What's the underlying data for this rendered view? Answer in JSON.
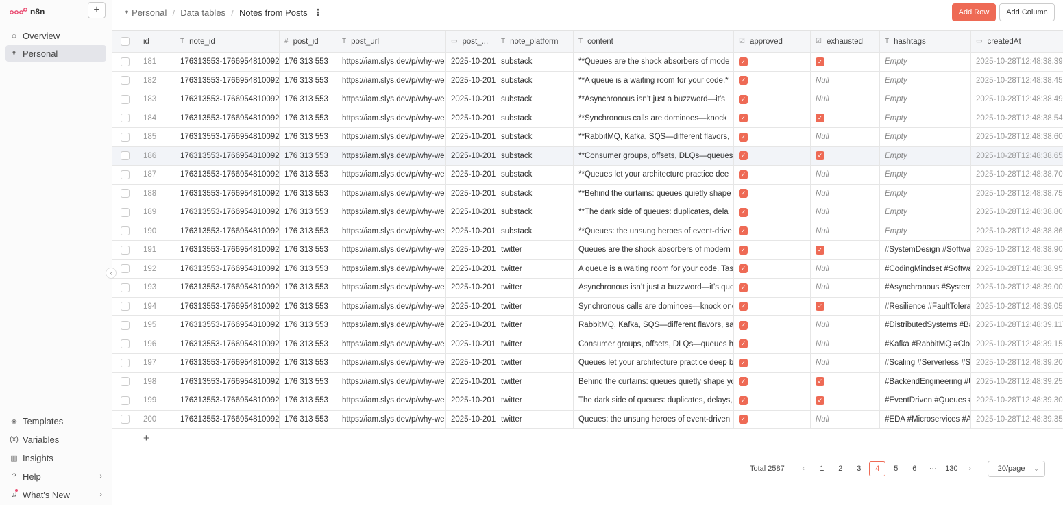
{
  "app": {
    "name": "n8n"
  },
  "sidebar": {
    "top": [
      {
        "label": "Overview",
        "icon": "home-icon"
      },
      {
        "label": "Personal",
        "icon": "user-icon"
      }
    ],
    "bottom": [
      {
        "label": "Templates",
        "icon": "templates-icon"
      },
      {
        "label": "Variables",
        "icon": "variables-icon"
      },
      {
        "label": "Insights",
        "icon": "insights-icon"
      },
      {
        "label": "Help",
        "icon": "help-icon"
      },
      {
        "label": "What's New",
        "icon": "bell-icon"
      }
    ]
  },
  "breadcrumb": {
    "personal": "Personal",
    "tables": "Data tables",
    "current": "Notes from Posts"
  },
  "toolbar": {
    "add_row": "Add Row",
    "add_column": "Add Column"
  },
  "table": {
    "headers": {
      "id": "id",
      "note_id": "note_id",
      "post_id": "post_id",
      "post_url": "post_url",
      "post_date": "post_...",
      "note_platform": "note_platform",
      "content": "content",
      "approved": "approved",
      "exhausted": "exhausted",
      "hashtags": "hashtags",
      "createdAt": "createdAt"
    },
    "rows": [
      {
        "id": "181",
        "note_id": "176313553-1766954810092-",
        "post_id": "176 313 553",
        "post_url": "https://iam.slys.dev/p/why-we",
        "post_date": "2025-10-201",
        "platform": "substack",
        "content": "**Queues are the shock absorbers of mode",
        "approved": true,
        "exhausted": true,
        "hashtags": "Empty",
        "createdAt": "2025-10-28T12:48:38.39"
      },
      {
        "id": "182",
        "note_id": "176313553-1766954810092-",
        "post_id": "176 313 553",
        "post_url": "https://iam.slys.dev/p/why-we",
        "post_date": "2025-10-201",
        "platform": "substack",
        "content": "**A queue is a waiting room for your code.*",
        "approved": true,
        "exhausted": false,
        "hashtags": "Empty",
        "createdAt": "2025-10-28T12:48:38.45"
      },
      {
        "id": "183",
        "note_id": "176313553-1766954810092-",
        "post_id": "176 313 553",
        "post_url": "https://iam.slys.dev/p/why-we",
        "post_date": "2025-10-201",
        "platform": "substack",
        "content": "**Asynchronous isn’t just a buzzword—it’s ",
        "approved": true,
        "exhausted": false,
        "hashtags": "Empty",
        "createdAt": "2025-10-28T12:48:38.49"
      },
      {
        "id": "184",
        "note_id": "176313553-1766954810092-",
        "post_id": "176 313 553",
        "post_url": "https://iam.slys.dev/p/why-we",
        "post_date": "2025-10-201",
        "platform": "substack",
        "content": "**Synchronous calls are dominoes—knock",
        "approved": true,
        "exhausted": true,
        "hashtags": "Empty",
        "createdAt": "2025-10-28T12:48:38.54"
      },
      {
        "id": "185",
        "note_id": "176313553-1766954810092-",
        "post_id": "176 313 553",
        "post_url": "https://iam.slys.dev/p/why-we",
        "post_date": "2025-10-201",
        "platform": "substack",
        "content": "**RabbitMQ, Kafka, SQS—different flavors,",
        "approved": true,
        "exhausted": false,
        "hashtags": "Empty",
        "createdAt": "2025-10-28T12:48:38.60"
      },
      {
        "id": "186",
        "note_id": "176313553-1766954810092-",
        "post_id": "176 313 553",
        "post_url": "https://iam.slys.dev/p/why-we",
        "post_date": "2025-10-201",
        "platform": "substack",
        "content": "**Consumer groups, offsets, DLQs—queues",
        "approved": true,
        "exhausted": true,
        "hashtags": "Empty",
        "createdAt": "2025-10-28T12:48:38.65"
      },
      {
        "id": "187",
        "note_id": "176313553-1766954810092-",
        "post_id": "176 313 553",
        "post_url": "https://iam.slys.dev/p/why-we",
        "post_date": "2025-10-201",
        "platform": "substack",
        "content": "**Queues let your architecture practice dee",
        "approved": true,
        "exhausted": false,
        "hashtags": "Empty",
        "createdAt": "2025-10-28T12:48:38.70"
      },
      {
        "id": "188",
        "note_id": "176313553-1766954810092-",
        "post_id": "176 313 553",
        "post_url": "https://iam.slys.dev/p/why-we",
        "post_date": "2025-10-201",
        "platform": "substack",
        "content": "**Behind the curtains: queues quietly shape",
        "approved": true,
        "exhausted": false,
        "hashtags": "Empty",
        "createdAt": "2025-10-28T12:48:38.75"
      },
      {
        "id": "189",
        "note_id": "176313553-1766954810092-",
        "post_id": "176 313 553",
        "post_url": "https://iam.slys.dev/p/why-we",
        "post_date": "2025-10-201",
        "platform": "substack",
        "content": "**The dark side of queues: duplicates, dela",
        "approved": true,
        "exhausted": false,
        "hashtags": "Empty",
        "createdAt": "2025-10-28T12:48:38.80"
      },
      {
        "id": "190",
        "note_id": "176313553-1766954810092-",
        "post_id": "176 313 553",
        "post_url": "https://iam.slys.dev/p/why-we",
        "post_date": "2025-10-201",
        "platform": "substack",
        "content": "**Queues: the unsung heroes of event-drive",
        "approved": true,
        "exhausted": false,
        "hashtags": "Empty",
        "createdAt": "2025-10-28T12:48:38.86"
      },
      {
        "id": "191",
        "note_id": "176313553-1766954810092-",
        "post_id": "176 313 553",
        "post_url": "https://iam.slys.dev/p/why-we",
        "post_date": "2025-10-201",
        "platform": "twitter",
        "content": "Queues are the shock absorbers of modern",
        "approved": true,
        "exhausted": true,
        "hashtags": "#SystemDesign #Softwa",
        "createdAt": "2025-10-28T12:48:38.90"
      },
      {
        "id": "192",
        "note_id": "176313553-1766954810092-",
        "post_id": "176 313 553",
        "post_url": "https://iam.slys.dev/p/why-we",
        "post_date": "2025-10-201",
        "platform": "twitter",
        "content": "A queue is a waiting room for your code. Tas",
        "approved": true,
        "exhausted": false,
        "hashtags": "#CodingMindset #Softwa",
        "createdAt": "2025-10-28T12:48:38.95"
      },
      {
        "id": "193",
        "note_id": "176313553-1766954810092-",
        "post_id": "176 313 553",
        "post_url": "https://iam.slys.dev/p/why-we",
        "post_date": "2025-10-201",
        "platform": "twitter",
        "content": "Asynchronous isn’t just a buzzword—it’s que",
        "approved": true,
        "exhausted": false,
        "hashtags": "#Asynchronous #System",
        "createdAt": "2025-10-28T12:48:39.00"
      },
      {
        "id": "194",
        "note_id": "176313553-1766954810092-",
        "post_id": "176 313 553",
        "post_url": "https://iam.slys.dev/p/why-we",
        "post_date": "2025-10-201",
        "platform": "twitter",
        "content": "Synchronous calls are dominoes—knock one",
        "approved": true,
        "exhausted": true,
        "hashtags": "#Resilience #FaultTolera",
        "createdAt": "2025-10-28T12:48:39.05"
      },
      {
        "id": "195",
        "note_id": "176313553-1766954810092-",
        "post_id": "176 313 553",
        "post_url": "https://iam.slys.dev/p/why-we",
        "post_date": "2025-10-201",
        "platform": "twitter",
        "content": "RabbitMQ, Kafka, SQS—different flavors, sar",
        "approved": true,
        "exhausted": false,
        "hashtags": "#DistributedSystems #Ba",
        "createdAt": "2025-10-28T12:48:39.117"
      },
      {
        "id": "196",
        "note_id": "176313553-1766954810092-",
        "post_id": "176 313 553",
        "post_url": "https://iam.slys.dev/p/why-we",
        "post_date": "2025-10-201",
        "platform": "twitter",
        "content": "Consumer groups, offsets, DLQs—queues ha",
        "approved": true,
        "exhausted": false,
        "hashtags": "#Kafka #RabbitMQ #Clou",
        "createdAt": "2025-10-28T12:48:39.159"
      },
      {
        "id": "197",
        "note_id": "176313553-1766954810092-",
        "post_id": "176 313 553",
        "post_url": "https://iam.slys.dev/p/why-we",
        "post_date": "2025-10-201",
        "platform": "twitter",
        "content": "Queues let your architecture practice deep b",
        "approved": true,
        "exhausted": false,
        "hashtags": "#Scaling #Serverless #S",
        "createdAt": "2025-10-28T12:48:39.20"
      },
      {
        "id": "198",
        "note_id": "176313553-1766954810092-",
        "post_id": "176 313 553",
        "post_url": "https://iam.slys.dev/p/why-we",
        "post_date": "2025-10-201",
        "platform": "twitter",
        "content": "Behind the curtains: queues quietly shape yo",
        "approved": true,
        "exhausted": true,
        "hashtags": "#BackendEngineering #U",
        "createdAt": "2025-10-28T12:48:39.25"
      },
      {
        "id": "199",
        "note_id": "176313553-1766954810092-",
        "post_id": "176 313 553",
        "post_url": "https://iam.slys.dev/p/why-we",
        "post_date": "2025-10-201",
        "platform": "twitter",
        "content": "The dark side of queues: duplicates, delays,",
        "approved": true,
        "exhausted": true,
        "hashtags": "#EventDriven #Queues #",
        "createdAt": "2025-10-28T12:48:39.30"
      },
      {
        "id": "200",
        "note_id": "176313553-1766954810092-",
        "post_id": "176 313 553",
        "post_url": "https://iam.slys.dev/p/why-we",
        "post_date": "2025-10-201",
        "platform": "twitter",
        "content": "Queues: the unsung heroes of event-driven",
        "approved": true,
        "exhausted": false,
        "hashtags": "#EDA #Microservices #A",
        "createdAt": "2025-10-28T12:48:39.35"
      }
    ],
    "null_label": "Null",
    "highlighted_row": "186"
  },
  "pagination": {
    "total": "Total 2587",
    "pages": [
      "1",
      "2",
      "3",
      "4",
      "5",
      "6",
      "···",
      "130"
    ],
    "current": "4",
    "per_page": "20/page"
  },
  "colors": {
    "accent": "#ee6a55"
  }
}
